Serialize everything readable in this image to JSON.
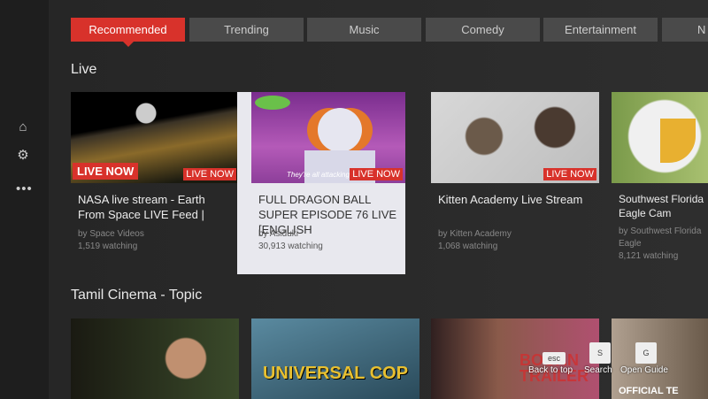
{
  "sidebar": {
    "icons": [
      "home-icon",
      "gear-icon",
      "more-icon"
    ]
  },
  "tabs": [
    "Recommended",
    "Trending",
    "Music",
    "Comedy",
    "Entertainment",
    "N"
  ],
  "shelves": [
    {
      "title": "Live",
      "cards": [
        {
          "title": "NASA live stream - Earth From Space LIVE Feed |",
          "channel": "by Space Videos",
          "meta": "1,519 watching",
          "badge": "LIVE NOW",
          "overlay": "LIVE NOW"
        },
        {
          "title": "FULL DRAGON BALL SUPER EPISODE 76 LIVE [ENGLISH",
          "channel": "by Asiduki",
          "meta": "30,913 watching",
          "badge": "LIVE NOW",
          "caption": "They're all attacking us, hu"
        },
        {
          "title": "Kitten Academy Live Stream",
          "channel": "by Kitten Academy",
          "meta": "1,068 watching",
          "badge": "LIVE NOW"
        },
        {
          "title": "Southwest Florida Eagle Cam",
          "channel": "by Southwest Florida Eagle",
          "meta": "8,121 watching"
        }
      ]
    },
    {
      "title": "Tamil Cinema - Topic",
      "cards": [
        {
          "thumb_text": ""
        },
        {
          "thumb_text": "UNIVERSAL COP"
        },
        {
          "thumb_text": "BOGAN TRAILER"
        },
        {
          "thumb_text": "OFFICIAL TE"
        }
      ]
    }
  ],
  "hints": [
    {
      "key": "esc",
      "label": "Back to top"
    },
    {
      "key": "S",
      "label": "Search"
    },
    {
      "key": "G",
      "label": "Open Guide"
    }
  ]
}
